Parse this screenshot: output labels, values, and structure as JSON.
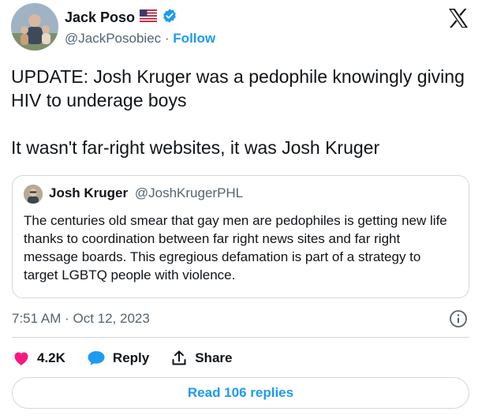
{
  "author": {
    "name": "Jack Poso",
    "flag_icon": "us-flag-icon",
    "verified_icon": "verified-badge-icon",
    "handle": "@JackPosobiec",
    "separator": "·",
    "follow_label": "Follow"
  },
  "platform_icon": "x-logo-icon",
  "tweet": {
    "line1": "UPDATE: Josh Kruger was a pedophile knowingly giving HIV to underage boys",
    "line2": "It wasn't far-right websites, it was Josh Kruger"
  },
  "quoted": {
    "name": "Josh Kruger",
    "handle": "@JoshKrugerPHL",
    "text": "The centuries old smear that gay men are pedophiles is getting new life thanks to coordination between far right news sites and far right message boards. This egregious defamation is part of a strategy to target LGBTQ people with violence."
  },
  "timestamp": "7:51 AM · Oct 12, 2023",
  "actions": {
    "likes": "4.2K",
    "reply_label": "Reply",
    "share_label": "Share"
  },
  "read_replies_label": "Read 106 replies",
  "colors": {
    "accent": "#1d9bf0",
    "like": "#f91880",
    "text": "#0f1419",
    "muted": "#536471",
    "border": "#cfd9de"
  }
}
